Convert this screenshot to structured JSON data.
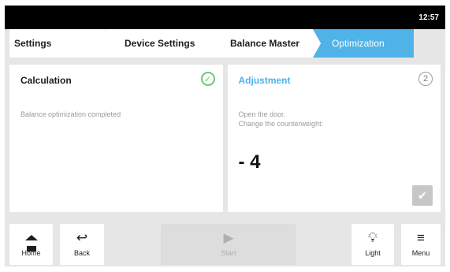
{
  "status_bar": {
    "time": "12:57"
  },
  "breadcrumb": [
    "Settings",
    "Device Settings",
    "Balance Master",
    "Optimization"
  ],
  "calculation": {
    "title": "Calculation",
    "status_icon": "check-circle-icon",
    "message": "Balance optimization completed"
  },
  "adjustment": {
    "title": "Adjustment",
    "step": "2",
    "line1": "Open the door.",
    "line2": "Change the counterweight:",
    "value": "- 4",
    "confirm_icon": "check-icon"
  },
  "bottom_bar": {
    "home": "Home",
    "back": "Back",
    "start": "Start",
    "light": "Light",
    "menu": "Menu"
  }
}
